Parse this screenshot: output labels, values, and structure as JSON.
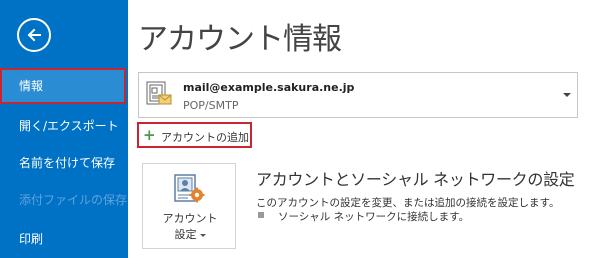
{
  "sidebar": {
    "back_label": "",
    "items": [
      {
        "label": "情報"
      },
      {
        "label": "開く/エクスポート"
      },
      {
        "label": "名前を付けて保存"
      },
      {
        "label": "添付ファイルの保存"
      },
      {
        "label": "印刷"
      }
    ]
  },
  "main": {
    "title": "アカウント情報",
    "account": {
      "email": "mail@example.sakura.ne.jp",
      "type": "POP/SMTP"
    },
    "add_account_label": "アカウントの追加",
    "settings_tile": {
      "line1": "アカウント",
      "line2": "設定"
    },
    "section": {
      "heading": "アカウントとソーシャル ネットワークの設定",
      "description": "このアカウントの設定を変更、または追加の接続を設定します。",
      "bullet": "ソーシャル ネットワークに接続します。"
    }
  },
  "colors": {
    "sidebar_bg": "#0072C6",
    "selected_bg": "#2A8DD4",
    "highlight_border": "#C9252E",
    "add_plus": "#4C9A4A"
  },
  "icons": [
    "back-arrow-icon",
    "account-card-icon",
    "plus-icon",
    "account-settings-icon",
    "dropdown-caret-icon"
  ]
}
